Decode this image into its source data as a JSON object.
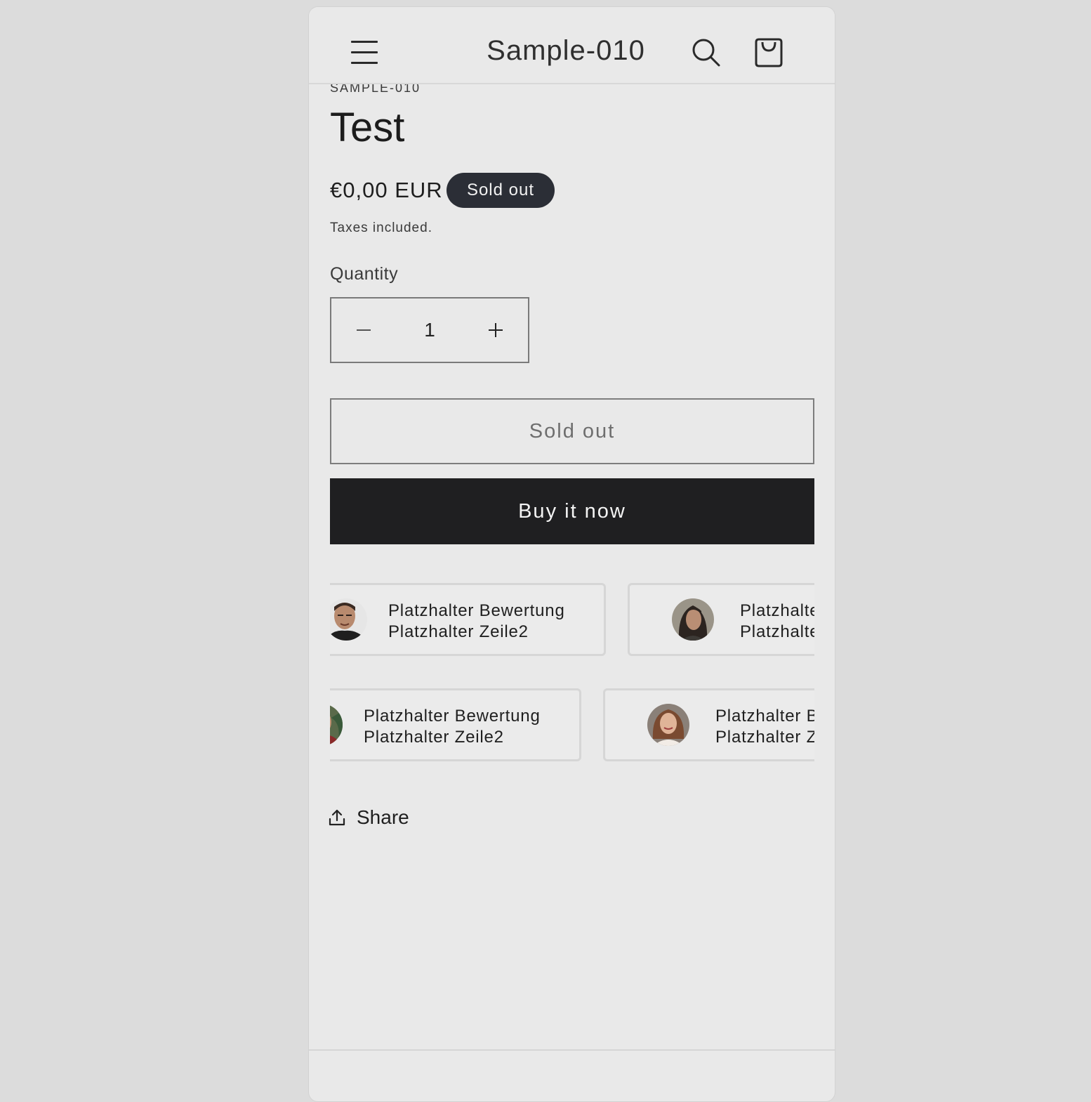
{
  "header": {
    "store_name": "Sample-010"
  },
  "product": {
    "vendor": "SAMPLE-010",
    "title": "Test",
    "price": "€0,00 EUR",
    "badge": "Sold out",
    "taxes_note": "Taxes included."
  },
  "quantity": {
    "label": "Quantity",
    "value": "1"
  },
  "actions": {
    "soldout_label": "Sold out",
    "buy_label": "Buy it now"
  },
  "reviews": {
    "row1": [
      {
        "line1": "Platzhalter Bewertung",
        "line2": "Platzhalter Zeile2"
      },
      {
        "line1": "Platzhalte",
        "line2": "Platzhalte"
      }
    ],
    "row2": [
      {
        "line1": "Platzhalter Bewertung",
        "line2": "Platzhalter Zeile2"
      },
      {
        "line1": "Platzhalter B",
        "line2": "Platzhalter Z"
      }
    ]
  },
  "share": {
    "label": "Share"
  }
}
